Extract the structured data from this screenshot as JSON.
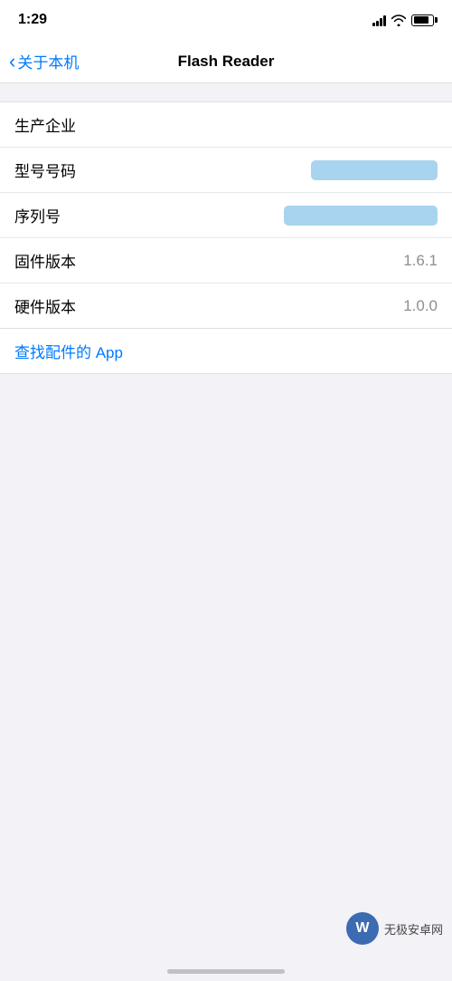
{
  "statusBar": {
    "time": "1:29",
    "signalLabel": "signal",
    "wifiLabel": "wifi",
    "batteryLabel": "battery"
  },
  "navBar": {
    "backLabel": "关于本机",
    "title": "Flash Reader"
  },
  "rows": [
    {
      "label": "生产企业",
      "valueType": "empty",
      "value": ""
    },
    {
      "label": "型号号码",
      "valueType": "redacted-short",
      "value": ""
    },
    {
      "label": "序列号",
      "valueType": "redacted-long",
      "value": ""
    },
    {
      "label": "固件版本",
      "valueType": "text",
      "value": "1.6.1"
    },
    {
      "label": "硬件版本",
      "valueType": "text",
      "value": "1.0.0"
    }
  ],
  "linkRow": {
    "text": "查找配件的 App"
  },
  "watermark": {
    "logoText": "W",
    "text": "无极安卓网",
    "url": "wjhotelgroup.com"
  }
}
